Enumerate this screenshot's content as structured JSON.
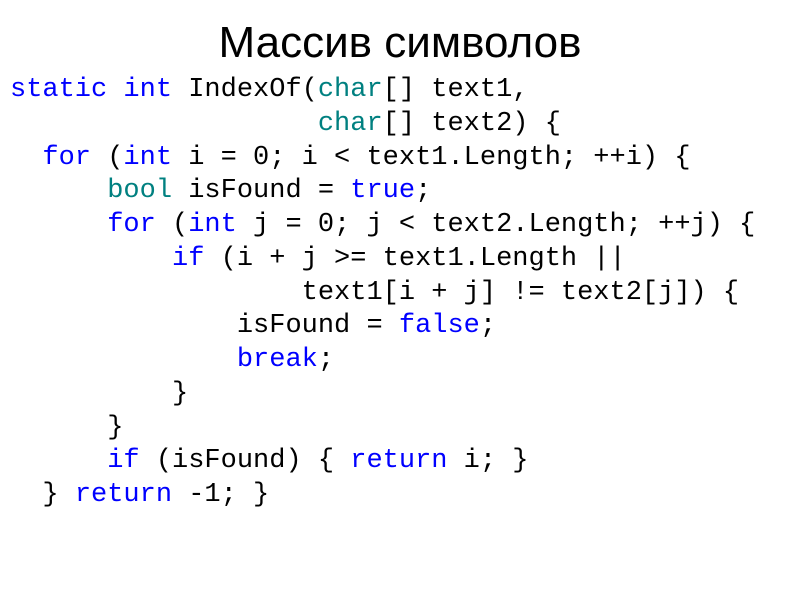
{
  "slide": {
    "title": "Массив символов"
  },
  "code": {
    "kw_static": "static",
    "kw_int1": "int",
    "fn_name": " IndexOf(",
    "typ_char1": "char",
    "sig_rest1": "[] text1,",
    "indent_param2": "                   ",
    "typ_char2": "char",
    "sig_rest2": "[] text2) {",
    "for1_indent": "  ",
    "kw_for1": "for",
    "for1_open": " (",
    "kw_int2": "int",
    "for1_cond": " i = 0; i < text1.Length; ++i) {",
    "bool_indent": "      ",
    "typ_bool": "bool",
    "isfound_decl_mid": " isFound = ",
    "kw_true": "true",
    "semicolon1": ";",
    "for2_indent": "      ",
    "kw_for2": "for",
    "for2_open": " (",
    "kw_int3": "int",
    "for2_cond": " j = 0; j < text2.Length; ++j) {",
    "if_indent": "          ",
    "kw_if": "if",
    "if_cond1": " (i + j >= text1.Length ||",
    "if_cond2_indent": "                  ",
    "if_cond2": "text1[i + j] != text2[j]) {",
    "setfalse_indent": "              ",
    "setfalse_pre": "isFound = ",
    "kw_false": "false",
    "semicolon2": ";",
    "break_indent": "              ",
    "kw_break": "break",
    "semicolon3": ";",
    "close_inner_if_indent": "          ",
    "close_brace1": "}",
    "close_for2_indent": "      ",
    "close_brace2": "}",
    "iffound_indent": "      ",
    "kw_if2": "if",
    "iffound_open": " (isFound) { ",
    "kw_return1": "return",
    "iffound_rest": " i; }",
    "lastline_indent": "  ",
    "close_brace3": "} ",
    "kw_return2": "return",
    "lastline_rest": " -1; }"
  }
}
